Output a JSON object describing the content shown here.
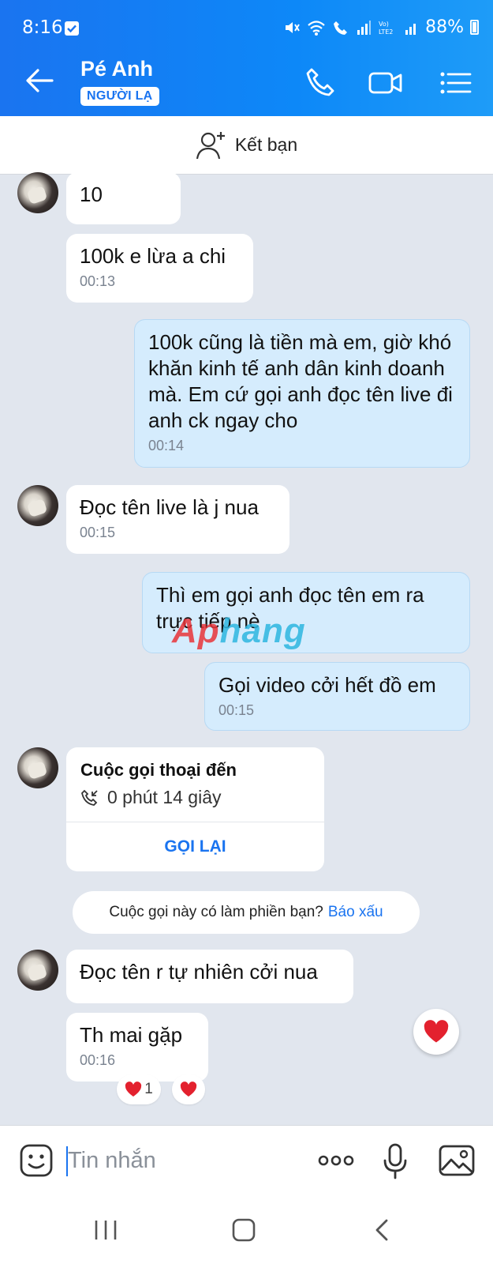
{
  "status": {
    "time": "8:16",
    "battery": "88%"
  },
  "header": {
    "name": "Pé Anh",
    "badge": "NGƯỜI LẠ"
  },
  "add_friend": {
    "label": "Kết bạn"
  },
  "messages": [
    {
      "text": "10",
      "time": ""
    },
    {
      "text": "100k e lừa a chi",
      "time": "00:13"
    },
    {
      "text": "100k cũng là tiền mà em, giờ khó khăn kinh tế anh dân kinh doanh mà. Em cứ gọi anh đọc tên live đi anh ck ngay cho",
      "time": "00:14"
    },
    {
      "text": "Đọc tên live là j nua",
      "time": "00:15"
    },
    {
      "text": "Thì em gọi anh đọc tên em ra trực tiếp nè",
      "time": ""
    },
    {
      "text": "Gọi video cởi hết đồ em",
      "time": "00:15"
    },
    {
      "text": "Đọc tên r tự nhiên cởi nua",
      "time": ""
    },
    {
      "text": "Th mai gặp",
      "time": "00:16"
    }
  ],
  "call": {
    "title": "Cuộc gọi thoại đến",
    "duration": "0 phút 14 giây",
    "callback": "GỌI LẠI"
  },
  "notice": {
    "text": "Cuộc gọi này có làm phiền bạn?",
    "report": "Báo xấu"
  },
  "reactions": {
    "count": "1"
  },
  "watermark": {
    "part1": "Ap",
    "part2": "hang"
  },
  "input": {
    "placeholder": "Tin nhắn"
  },
  "colors": {
    "accent": "#1a74f0",
    "header": "#0d88f8",
    "outgoing": "#d5ecfd",
    "background": "#e1e6ee"
  }
}
